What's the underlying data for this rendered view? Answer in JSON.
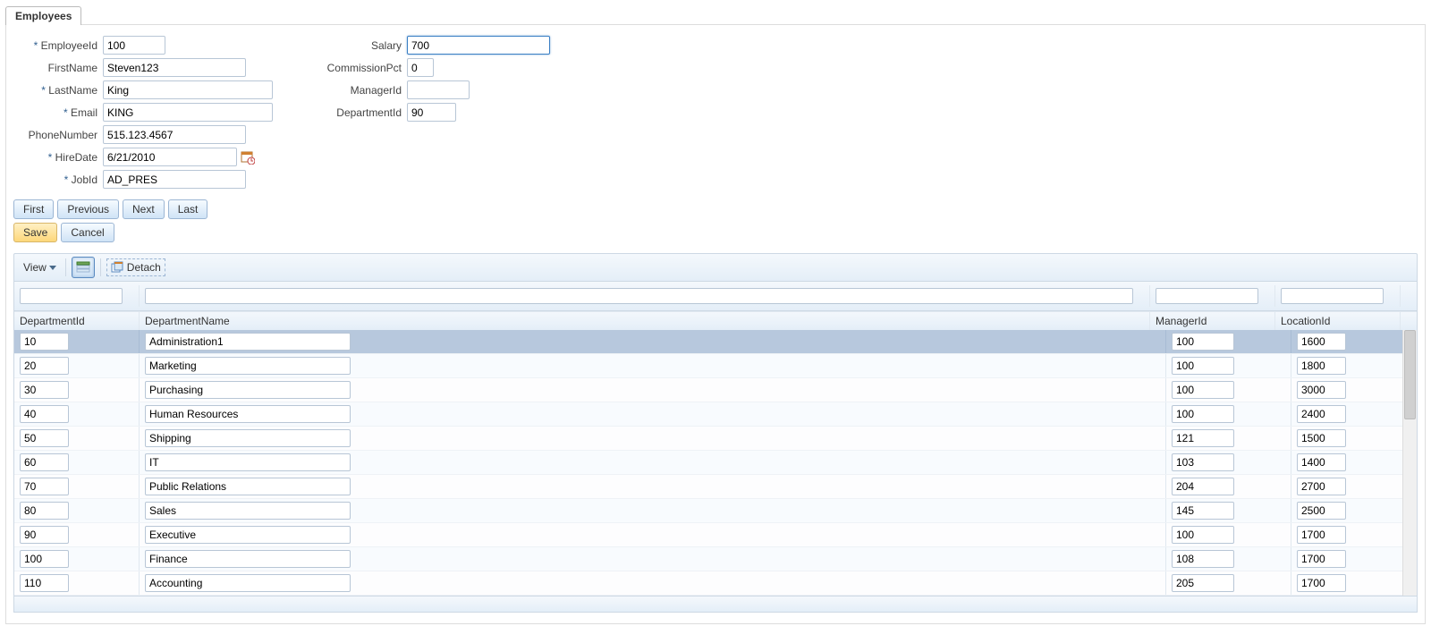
{
  "tab": {
    "label": "Employees"
  },
  "form": {
    "left": [
      {
        "id": "employeeId",
        "label": "EmployeeId",
        "required": true,
        "value": "100",
        "cls": "w-sm"
      },
      {
        "id": "firstName",
        "label": "FirstName",
        "required": false,
        "value": "Steven123",
        "cls": "w-md"
      },
      {
        "id": "lastName",
        "label": "LastName",
        "required": true,
        "value": "King",
        "cls": "w-lg"
      },
      {
        "id": "email",
        "label": "Email",
        "required": true,
        "value": "KING",
        "cls": "w-lg"
      },
      {
        "id": "phone",
        "label": "PhoneNumber",
        "required": false,
        "value": "515.123.4567",
        "cls": "w-md"
      },
      {
        "id": "hireDate",
        "label": "HireDate",
        "required": true,
        "value": "6/21/2010",
        "cls": "w-date",
        "hasDateIcon": true
      },
      {
        "id": "jobId",
        "label": "JobId",
        "required": true,
        "value": "AD_PRES",
        "cls": "w-md"
      }
    ],
    "right": [
      {
        "id": "salary",
        "label": "Salary",
        "required": false,
        "value": "700",
        "cls": "w-salary",
        "focused": true
      },
      {
        "id": "commissionPct",
        "label": "CommissionPct",
        "required": false,
        "value": "0",
        "cls": "w-cp"
      },
      {
        "id": "managerId",
        "label": "ManagerId",
        "required": false,
        "value": "",
        "cls": "w-mgr"
      },
      {
        "id": "departmentId",
        "label": "DepartmentId",
        "required": false,
        "value": "90",
        "cls": "w-dep"
      }
    ]
  },
  "nav": {
    "first": "First",
    "previous": "Previous",
    "next": "Next",
    "last": "Last"
  },
  "actions": {
    "save": "Save",
    "cancel": "Cancel"
  },
  "toolbar": {
    "view": "View",
    "detach": "Detach"
  },
  "grid": {
    "headers": {
      "depId": "DepartmentId",
      "depName": "DepartmentName",
      "mgrId": "ManagerId",
      "locId": "LocationId"
    },
    "rows": [
      {
        "depId": "10",
        "depName": "Administration1",
        "mgrId": "100",
        "locId": "1600",
        "selected": true
      },
      {
        "depId": "20",
        "depName": "Marketing",
        "mgrId": "100",
        "locId": "1800"
      },
      {
        "depId": "30",
        "depName": "Purchasing",
        "mgrId": "100",
        "locId": "3000"
      },
      {
        "depId": "40",
        "depName": "Human Resources",
        "mgrId": "100",
        "locId": "2400"
      },
      {
        "depId": "50",
        "depName": "Shipping",
        "mgrId": "121",
        "locId": "1500"
      },
      {
        "depId": "60",
        "depName": "IT",
        "mgrId": "103",
        "locId": "1400"
      },
      {
        "depId": "70",
        "depName": "Public Relations",
        "mgrId": "204",
        "locId": "2700"
      },
      {
        "depId": "80",
        "depName": "Sales",
        "mgrId": "145",
        "locId": "2500"
      },
      {
        "depId": "90",
        "depName": "Executive",
        "mgrId": "100",
        "locId": "1700"
      },
      {
        "depId": "100",
        "depName": "Finance",
        "mgrId": "108",
        "locId": "1700"
      },
      {
        "depId": "110",
        "depName": "Accounting",
        "mgrId": "205",
        "locId": "1700"
      }
    ]
  }
}
